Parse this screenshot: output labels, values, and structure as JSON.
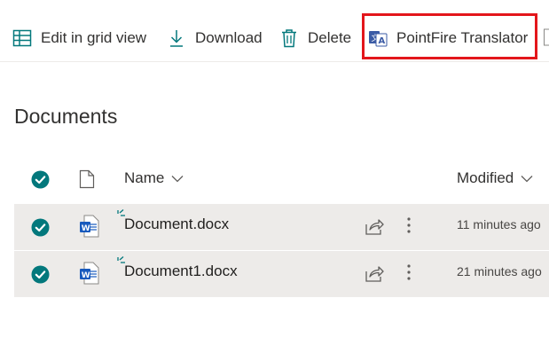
{
  "colors": {
    "accent": "#03787c",
    "highlight_border": "#e3161b",
    "selected_row": "#edebe9",
    "word_blue": "#185abd"
  },
  "toolbar": {
    "grid_label": "Edit in grid view",
    "grid_icon": "grid-icon",
    "download_label": "Download",
    "download_icon": "download-icon",
    "delete_label": "Delete",
    "delete_icon": "trash-icon",
    "translator_label": "PointFire Translator",
    "translator_icon": "translate-icon"
  },
  "page": {
    "title": "Documents"
  },
  "columns": {
    "name": "Name",
    "modified": "Modified"
  },
  "rows": [
    {
      "name": "Document.docx",
      "modified": "11 minutes ago",
      "selected": true,
      "icon": "word-file-icon"
    },
    {
      "name": "Document1.docx",
      "modified": "21 minutes ago",
      "selected": true,
      "icon": "word-file-icon"
    }
  ]
}
